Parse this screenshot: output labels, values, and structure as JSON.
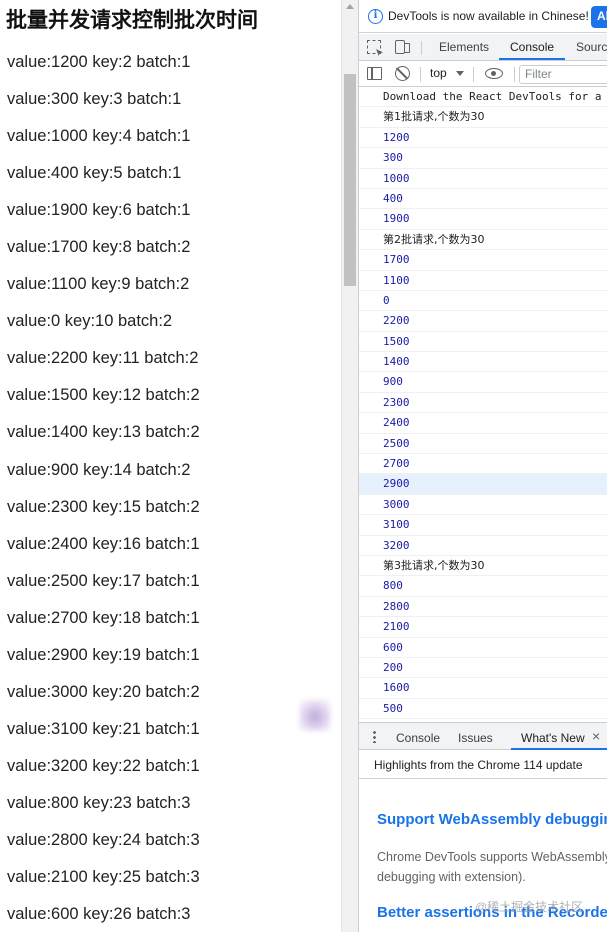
{
  "page": {
    "title": "批量并发请求控制批次时间",
    "items": [
      "value:1200 key:2 batch:1",
      "value:300 key:3 batch:1",
      "value:1000 key:4 batch:1",
      "value:400 key:5 batch:1",
      "value:1900 key:6 batch:1",
      "value:1700 key:8 batch:2",
      "value:1100 key:9 batch:2",
      "value:0 key:10 batch:2",
      "value:2200 key:11 batch:2",
      "value:1500 key:12 batch:2",
      "value:1400 key:13 batch:2",
      "value:900 key:14 batch:2",
      "value:2300 key:15 batch:2",
      "value:2400 key:16 batch:1",
      "value:2500 key:17 batch:1",
      "value:2700 key:18 batch:1",
      "value:2900 key:19 batch:1",
      "value:3000 key:20 batch:2",
      "value:3100 key:21 batch:1",
      "value:3200 key:22 batch:1",
      "value:800 key:23 batch:3",
      "value:2800 key:24 batch:3",
      "value:2100 key:25 batch:3",
      "value:600 key:26 batch:3"
    ]
  },
  "devtools": {
    "info_bar": {
      "text": "DevTools is now available in Chinese!",
      "button_label": "Al"
    },
    "tabs": {
      "elements": "Elements",
      "console": "Console",
      "sources": "Source"
    },
    "toolbar": {
      "context": "top",
      "filter_placeholder": "Filter"
    },
    "console_lines": [
      {
        "text": "Download the React DevTools for a",
        "kind": "info"
      },
      {
        "text": "第1批请求,个数为30",
        "kind": "head"
      },
      {
        "text": "1200",
        "kind": "num"
      },
      {
        "text": "300",
        "kind": "num"
      },
      {
        "text": "1000",
        "kind": "num"
      },
      {
        "text": "400",
        "kind": "num"
      },
      {
        "text": "1900",
        "kind": "num"
      },
      {
        "text": "第2批请求,个数为30",
        "kind": "head"
      },
      {
        "text": "1700",
        "kind": "num"
      },
      {
        "text": "1100",
        "kind": "num"
      },
      {
        "text": "0",
        "kind": "num"
      },
      {
        "text": "2200",
        "kind": "num"
      },
      {
        "text": "1500",
        "kind": "num"
      },
      {
        "text": "1400",
        "kind": "num"
      },
      {
        "text": "900",
        "kind": "num"
      },
      {
        "text": "2300",
        "kind": "num"
      },
      {
        "text": "2400",
        "kind": "num"
      },
      {
        "text": "2500",
        "kind": "num"
      },
      {
        "text": "2700",
        "kind": "num"
      },
      {
        "text": "2900",
        "kind": "num",
        "highlighted": true
      },
      {
        "text": "3000",
        "kind": "num"
      },
      {
        "text": "3100",
        "kind": "num"
      },
      {
        "text": "3200",
        "kind": "num"
      },
      {
        "text": "第3批请求,个数为30",
        "kind": "head"
      },
      {
        "text": "800",
        "kind": "num"
      },
      {
        "text": "2800",
        "kind": "num"
      },
      {
        "text": "2100",
        "kind": "num"
      },
      {
        "text": "600",
        "kind": "num"
      },
      {
        "text": "200",
        "kind": "num"
      },
      {
        "text": "1600",
        "kind": "num"
      },
      {
        "text": "500",
        "kind": "num"
      }
    ],
    "drawer": {
      "tabs": {
        "console": "Console",
        "issues": "Issues",
        "whats_new": "What's New"
      },
      "close_glyph": "×",
      "highlights": "Highlights from the Chrome 114 update",
      "heading1": "Support WebAssembly debugging",
      "paragraph": "Chrome DevTools supports WebAssembly debugging with extension).",
      "heading2": "Better assertions in the Recorder",
      "watermark": "@稀土掘金技术社区"
    },
    "icons": [
      "info-icon",
      "inspect-icon",
      "device-toggle-icon",
      "sidebar-icon",
      "clear-console-icon",
      "chevron-down-icon",
      "eye-icon",
      "more-vert-icon",
      "close-icon"
    ],
    "colors": {
      "accent": "#1a73e8",
      "console_number": "#1a1aa6",
      "highlight_row": "#e7f0fd"
    }
  }
}
